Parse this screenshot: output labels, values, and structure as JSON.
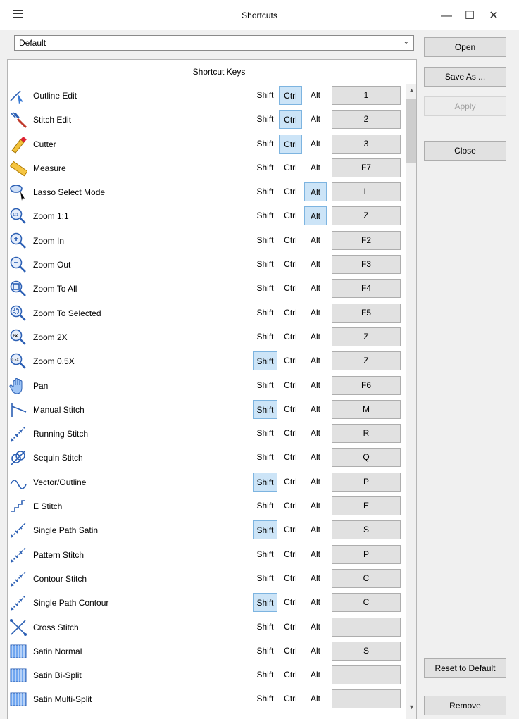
{
  "window": {
    "title": "Shortcuts"
  },
  "profile": {
    "selected": "Default"
  },
  "panel": {
    "header": "Shortcut Keys"
  },
  "modifiers": {
    "shift": "Shift",
    "ctrl": "Ctrl",
    "alt": "Alt"
  },
  "buttons": {
    "open": "Open",
    "save_as": "Save As ...",
    "apply": "Apply",
    "close": "Close",
    "reset": "Reset to Default",
    "remove": "Remove"
  },
  "rows": [
    {
      "label": "Outline Edit",
      "icon": "outline-edit-icon",
      "shift": false,
      "ctrl": true,
      "alt": false,
      "key": "1"
    },
    {
      "label": "Stitch Edit",
      "icon": "stitch-edit-icon",
      "shift": false,
      "ctrl": true,
      "alt": false,
      "key": "2"
    },
    {
      "label": "Cutter",
      "icon": "cutter-icon",
      "shift": false,
      "ctrl": true,
      "alt": false,
      "key": "3"
    },
    {
      "label": "Measure",
      "icon": "ruler-icon",
      "shift": false,
      "ctrl": false,
      "alt": false,
      "key": "F7"
    },
    {
      "label": "Lasso Select Mode",
      "icon": "lasso-select-icon",
      "shift": false,
      "ctrl": false,
      "alt": true,
      "key": "L"
    },
    {
      "label": "Zoom 1:1",
      "icon": "zoom-1-1-icon",
      "shift": false,
      "ctrl": false,
      "alt": true,
      "key": "Z"
    },
    {
      "label": "Zoom In",
      "icon": "zoom-in-icon",
      "shift": false,
      "ctrl": false,
      "alt": false,
      "key": "F2"
    },
    {
      "label": "Zoom Out",
      "icon": "zoom-out-icon",
      "shift": false,
      "ctrl": false,
      "alt": false,
      "key": "F3"
    },
    {
      "label": "Zoom To All",
      "icon": "zoom-to-all-icon",
      "shift": false,
      "ctrl": false,
      "alt": false,
      "key": "F4"
    },
    {
      "label": "Zoom To Selected",
      "icon": "zoom-to-selected-icon",
      "shift": false,
      "ctrl": false,
      "alt": false,
      "key": "F5"
    },
    {
      "label": "Zoom 2X",
      "icon": "zoom-2x-icon",
      "shift": false,
      "ctrl": false,
      "alt": false,
      "key": "Z"
    },
    {
      "label": "Zoom 0.5X",
      "icon": "zoom-half-icon",
      "shift": true,
      "ctrl": false,
      "alt": false,
      "key": "Z"
    },
    {
      "label": "Pan",
      "icon": "hand-icon",
      "shift": false,
      "ctrl": false,
      "alt": false,
      "key": "F6"
    },
    {
      "label": "Manual Stitch",
      "icon": "manual-stitch-icon",
      "shift": true,
      "ctrl": false,
      "alt": false,
      "key": "M"
    },
    {
      "label": "Running Stitch",
      "icon": "running-stitch-icon",
      "shift": false,
      "ctrl": false,
      "alt": false,
      "key": "R"
    },
    {
      "label": "Sequin Stitch",
      "icon": "sequin-stitch-icon",
      "shift": false,
      "ctrl": false,
      "alt": false,
      "key": "Q"
    },
    {
      "label": "Vector/Outline",
      "icon": "vector-outline-icon",
      "shift": true,
      "ctrl": false,
      "alt": false,
      "key": "P"
    },
    {
      "label": "E Stitch",
      "icon": "e-stitch-icon",
      "shift": false,
      "ctrl": false,
      "alt": false,
      "key": "E"
    },
    {
      "label": "Single Path Satin",
      "icon": "single-path-satin-icon",
      "shift": true,
      "ctrl": false,
      "alt": false,
      "key": "S"
    },
    {
      "label": "Pattern Stitch",
      "icon": "pattern-stitch-icon",
      "shift": false,
      "ctrl": false,
      "alt": false,
      "key": "P"
    },
    {
      "label": "Contour Stitch",
      "icon": "contour-stitch-icon",
      "shift": false,
      "ctrl": false,
      "alt": false,
      "key": "C"
    },
    {
      "label": "Single Path Contour",
      "icon": "single-path-contour-icon",
      "shift": true,
      "ctrl": false,
      "alt": false,
      "key": "C"
    },
    {
      "label": "Cross Stitch",
      "icon": "cross-stitch-icon",
      "shift": false,
      "ctrl": false,
      "alt": false,
      "key": ""
    },
    {
      "label": "Satin Normal",
      "icon": "satin-normal-icon",
      "shift": false,
      "ctrl": false,
      "alt": false,
      "key": "S"
    },
    {
      "label": "Satin  Bi-Split",
      "icon": "satin-bi-split-icon",
      "shift": false,
      "ctrl": false,
      "alt": false,
      "key": ""
    },
    {
      "label": "Satin Multi-Split",
      "icon": "satin-multi-split-icon",
      "shift": false,
      "ctrl": false,
      "alt": false,
      "key": ""
    }
  ]
}
